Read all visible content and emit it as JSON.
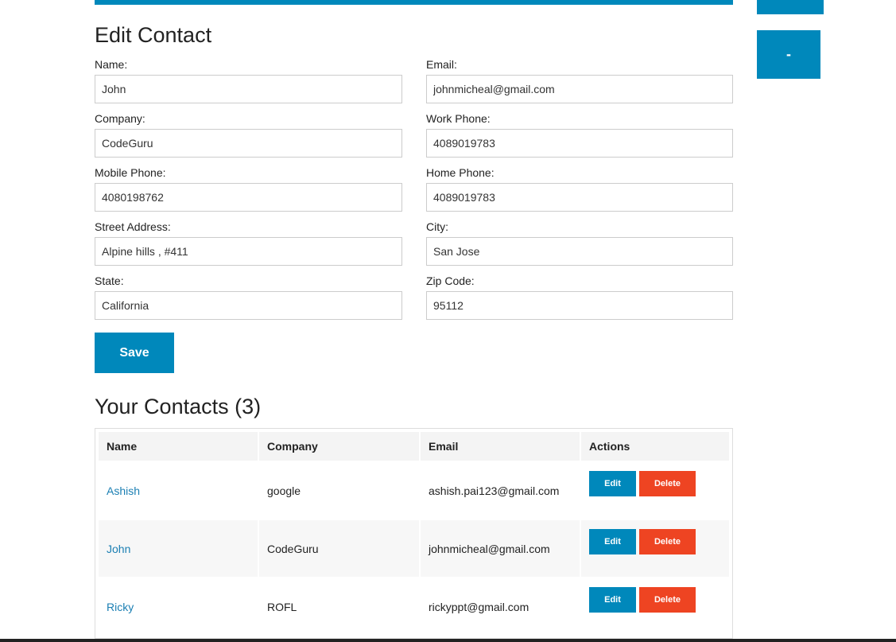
{
  "colors": {
    "primary": "#0088bb",
    "danger": "#ee4422",
    "link": "#1b7fb3"
  },
  "sidebar": {
    "minus_label": "-"
  },
  "form": {
    "title": "Edit Contact",
    "fields": {
      "name": {
        "label": "Name:",
        "value": "John"
      },
      "email": {
        "label": "Email:",
        "value": "johnmicheal@gmail.com"
      },
      "company": {
        "label": "Company:",
        "value": "CodeGuru"
      },
      "work_phone": {
        "label": "Work Phone:",
        "value": "4089019783"
      },
      "mobile_phone": {
        "label": "Mobile Phone:",
        "value": "4080198762"
      },
      "home_phone": {
        "label": "Home Phone:",
        "value": "4089019783"
      },
      "street": {
        "label": "Street Address:",
        "value": "Alpine hills , #411"
      },
      "city": {
        "label": "City:",
        "value": "San Jose"
      },
      "state": {
        "label": "State:",
        "value": "California"
      },
      "zip": {
        "label": "Zip Code:",
        "value": "95112"
      }
    },
    "save_label": "Save"
  },
  "contacts": {
    "title": "Your Contacts (3)",
    "headers": {
      "name": "Name",
      "company": "Company",
      "email": "Email",
      "actions": "Actions"
    },
    "edit_label": "Edit",
    "delete_label": "Delete",
    "rows": [
      {
        "name": "Ashish",
        "company": "google",
        "email": "ashish.pai123@gmail.com"
      },
      {
        "name": "John",
        "company": "CodeGuru",
        "email": "johnmicheal@gmail.com"
      },
      {
        "name": "Ricky",
        "company": "ROFL",
        "email": "rickyppt@gmail.com"
      }
    ]
  }
}
